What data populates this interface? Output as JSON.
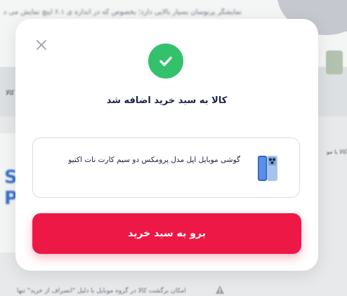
{
  "background": {
    "top_text": "نمایشگر پرنوسان بسیار بالایی دارد؛ بخصوص که در اندازه ی ۶.۱ اینچ نمایش می دهد",
    "left_label": "کالا",
    "left_brand": "S\nP",
    "right_label": "کالا با مو",
    "bottom_text": "امکان برگشت کالا در گروه موبایل با دلیل \"انصراف از خرید\" تنها"
  },
  "modal": {
    "title": "کالا به سبد خرید اضافه شد",
    "product": {
      "name": "گوشی موبایل اپل مدل پرومکس دو سیم کارت نات اکتیو"
    },
    "cart_button_label": "برو به سبد خرید"
  },
  "colors": {
    "success": "#33c26b",
    "primary": "#ee1846",
    "text": "#1b2240"
  },
  "icons": {
    "close": "close-icon",
    "success": "checkmark-icon",
    "warning": "warning-icon"
  }
}
